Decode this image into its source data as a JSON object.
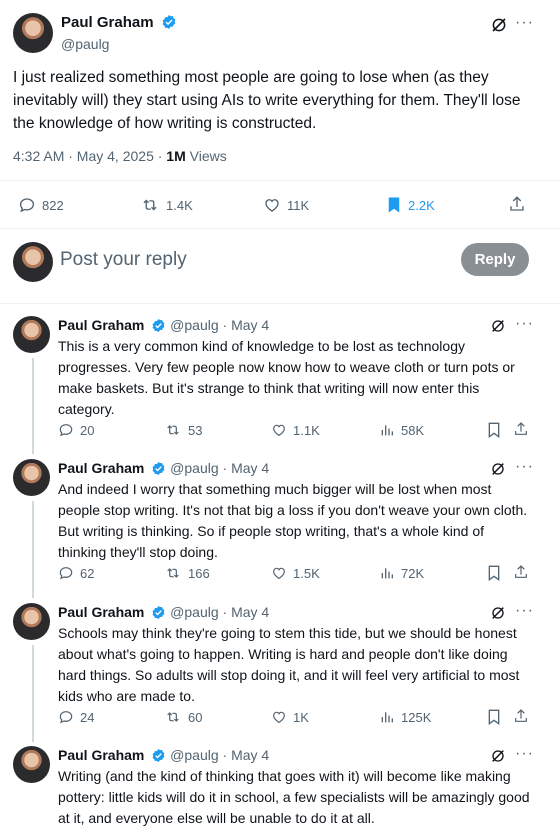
{
  "main": {
    "name": "Paul Graham",
    "handle": "@paulg",
    "text": "I just realized something most people are going to lose when (as they inevitably will) they start using AIs to write everything for them. They'll lose the knowledge of how writing is constructed.",
    "time": "4:32 AM · May 4, 2025 · ",
    "views_count": "1M",
    "views_label": " Views",
    "replies": "822",
    "reposts": "1.4K",
    "likes": "11K",
    "bookmarks": "2.2K"
  },
  "composer": {
    "placeholder": "Post your reply",
    "reply_label": "Reply"
  },
  "replies": [
    {
      "name": "Paul Graham",
      "meta": "@paulg · May 4",
      "text": "This is a very common kind of knowledge to be lost as technology progresses. Very few people now know how to weave cloth or turn pots or make baskets. But it's strange to think that writing will now enter this category.",
      "replies": "20",
      "reposts": "53",
      "likes": "1.1K",
      "views": "58K"
    },
    {
      "name": "Paul Graham",
      "meta": "@paulg · May 4",
      "text": "And indeed I worry that something much bigger will be lost when most people stop writing. It's not that big a loss if you don't weave your own cloth. But writing is thinking. So if people stop writing, that's a whole kind of thinking they'll stop doing.",
      "replies": "62",
      "reposts": "166",
      "likes": "1.5K",
      "views": "72K"
    },
    {
      "name": "Paul Graham",
      "meta": "@paulg · May 4",
      "text": "Schools may think they're going to stem this tide, but we should be honest about what's going to happen. Writing is hard and people don't like doing hard things. So adults will stop doing it, and it will feel very artificial to most kids who are made to.",
      "replies": "24",
      "reposts": "60",
      "likes": "1K",
      "views": "125K"
    },
    {
      "name": "Paul Graham",
      "meta": "@paulg · May 4",
      "text": "Writing (and the kind of thinking that goes with it) will become like making pottery: little kids will do it in school, a few specialists will be amazingly good at it, and everyone else will be unable to do it at all."
    }
  ],
  "icons": {
    "more": "···",
    "verified_color": "#1d9bf0",
    "bookmark_active_color": "#1d9bf0"
  }
}
